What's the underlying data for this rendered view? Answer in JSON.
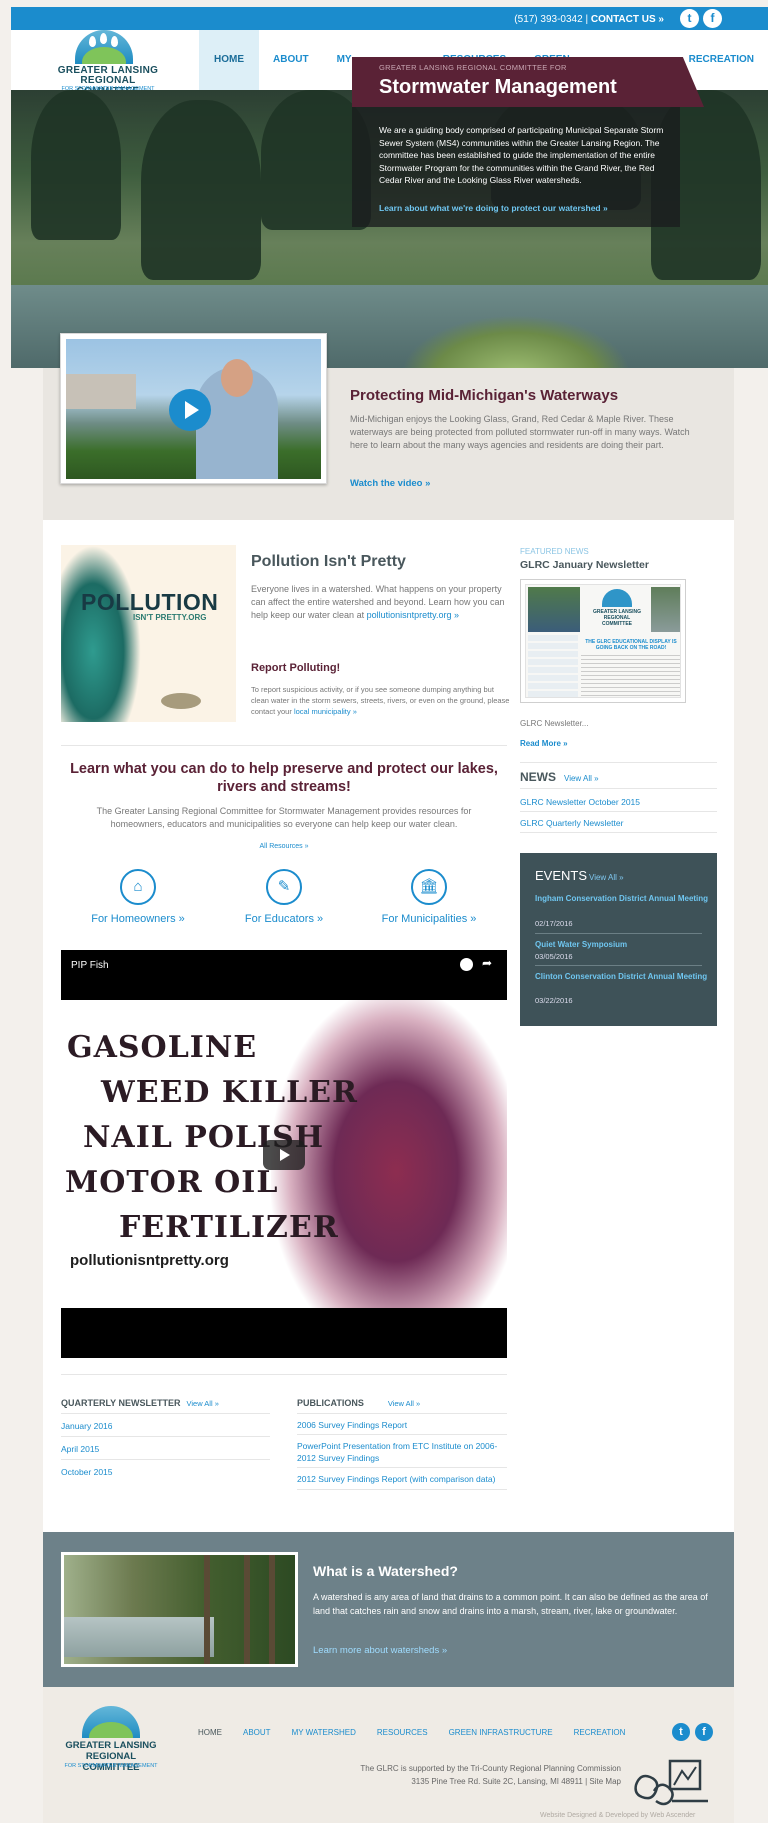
{
  "topbar": {
    "phone": "(517) 393-0342 |",
    "contact": "CONTACT US »",
    "twitter": "t",
    "facebook": "f"
  },
  "logo": {
    "line1": "GREATER LANSING",
    "line2": "REGIONAL COMMITTEE",
    "line3": "FOR STORMWATER MANAGEMENT"
  },
  "nav": [
    "HOME",
    "ABOUT",
    "MY WATERSHED",
    "RESOURCES",
    "GREEN INFRASTRUCTURE",
    "RECREATION"
  ],
  "hero": {
    "subtitle": "GREATER LANSING REGIONAL COMMITTEE FOR",
    "title": "Stormwater Management",
    "body": "We are a guiding body comprised of participating Municipal Separate Storm Sewer System (MS4) communities within the Greater Lansing Region. The committee has been established to guide the implementation of the entire Stormwater Program for the communities within the Grand River, the Red Cedar River and the Looking Glass River watersheds.",
    "link": "Learn about what we're doing to protect our watershed »"
  },
  "video_feature": {
    "title": "Protecting Mid-Michigan's Waterways",
    "text": "Mid-Michigan enjoys the Looking Glass, Grand, Red Cedar & Maple River. These waterways are being protected from polluted stormwater run-off in many ways. Watch here to learn about the many ways agencies and residents are doing their part.",
    "link": "Watch the video »"
  },
  "pollution": {
    "image_word": "POLLUTION",
    "image_word2": "ISN'T PRETTY.ORG",
    "title": "Pollution Isn't Pretty",
    "text": "Everyone lives in a watershed. What happens on your property can affect the entire watershed and beyond. Learn how you can help keep our water clean at",
    "link": "pollutionisntpretty.org »",
    "report_title": "Report Polluting!",
    "report_text": "To report suspicious activity, or if you see someone dumping anything but clean water in the storm sewers, streets, rivers, or even on the ground, please contact your",
    "report_link": "local municipality »"
  },
  "learn": {
    "title": "Learn what you can do to help preserve and protect our lakes, rivers and streams!",
    "text": "The Greater Lansing Regional Committee for Stormwater Management provides resources for homeowners, educators and municipalities so everyone can help keep our water clean.",
    "all_resources": "All Resources »",
    "audiences": [
      {
        "label": "For Homeowners »",
        "icon": "house-icon"
      },
      {
        "label": "For Educators »",
        "icon": "pencil-icon"
      },
      {
        "label": "For Municipalities »",
        "icon": "building-icon"
      }
    ]
  },
  "embed": {
    "title": "PIP Fish",
    "words": [
      "GASOLINE",
      "WEED KILLER",
      "NAIL POLISH",
      "MOTOR OIL",
      "FERTILIZER"
    ],
    "url": "pollutionisntpretty.org"
  },
  "quarterly": {
    "heading": "QUARTERLY NEWSLETTER",
    "view_all": "View All »",
    "items": [
      "January 2016",
      "April 2015",
      "October 2015"
    ]
  },
  "publications": {
    "heading": "PUBLICATIONS",
    "view_all": "View All »",
    "items": [
      "2006 Survey Findings Report",
      "PowerPoint Presentation from ETC Institute on 2006-2012 Survey Findings",
      "2012 Survey Findings Report (with comparison data)"
    ]
  },
  "featured": {
    "label": "FEATURED NEWS",
    "title": "GLRC January Newsletter",
    "thumb_headline": "THE GLRC EDUCATIONAL DISPLAY IS GOING BACK ON THE ROAD!",
    "caption": "GLRC Newsletter...",
    "read_more": "Read More »"
  },
  "news": {
    "heading": "NEWS",
    "view_all": "View All »",
    "items": [
      "GLRC Newsletter October 2015",
      "GLRC Quarterly Newsletter"
    ]
  },
  "events": {
    "heading": "EVENTS",
    "view_all": "View All »",
    "items": [
      {
        "title": "Ingham Conservation District Annual Meeting",
        "date": "02/17/2016"
      },
      {
        "title": "Quiet Water Symposium",
        "date": "03/05/2016"
      },
      {
        "title": "Clinton Conservation District Annual Meeting",
        "date": "03/22/2016"
      }
    ]
  },
  "watershed": {
    "title": "What is a Watershed?",
    "text": "A watershed is any area of land that drains to a common point. It can also be defined as the area of land that catches rain and snow and drains into a marsh, stream, river, lake or groundwater.",
    "link": "Learn more about watersheds »"
  },
  "footer": {
    "nav": [
      "HOME",
      "ABOUT",
      "MY WATERSHED",
      "RESOURCES",
      "GREEN INFRASTRUCTURE",
      "RECREATION"
    ],
    "support": "The GLRC is supported by the Tri-County Regional Planning Commission",
    "address": "3135 Pine Tree Rd. Suite 2C, Lansing, MI 48911 |",
    "sitemap": "Site Map",
    "credit": "Website Designed & Developed by Web Ascender"
  }
}
